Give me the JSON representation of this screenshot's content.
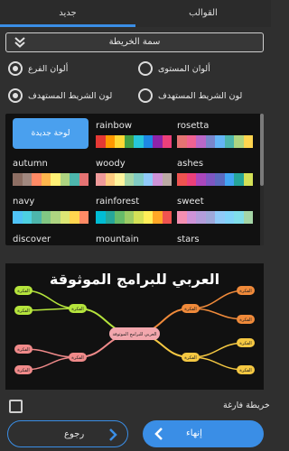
{
  "tabs": {
    "new": "جديد",
    "templates": "القوالب"
  },
  "theme_select": {
    "label": "سمة الخريطة"
  },
  "radios": {
    "level_colors": "ألوان المستوى",
    "branch_colors": "ألوان الفرع",
    "target_bar_colors_left": "لون الشريط المستهدف",
    "target_bar_colors_right": "لون الشريط المستهدف"
  },
  "new_board": "لوحة جديدة",
  "themes": [
    {
      "name": "rainbow",
      "colors": [
        "#e53935",
        "#ff9800",
        "#fdd835",
        "#43a047",
        "#26c6da",
        "#1e88e5",
        "#8e24aa",
        "#ec407a"
      ]
    },
    {
      "name": "rosetta",
      "colors": [
        "#e57373",
        "#f06292",
        "#ba68c8",
        "#7986cb",
        "#64b5f6",
        "#4db6ac",
        "#aed581",
        "#ffd54f"
      ]
    },
    {
      "name": "autumn",
      "colors": [
        "#8d6e63",
        "#a1887f",
        "#ff8a65",
        "#ffb74d",
        "#fff176",
        "#aed581",
        "#4db6ac",
        "#e57373"
      ]
    },
    {
      "name": "woody",
      "colors": [
        "#ef9a9a",
        "#ffcc80",
        "#fff59d",
        "#a5d6a7",
        "#80cbc4",
        "#90caf9",
        "#ce93d8",
        "#bcaaa4"
      ]
    },
    {
      "name": "ashes",
      "colors": [
        "#ef5350",
        "#ec407a",
        "#ab47bc",
        "#7e57c2",
        "#5c6bc0",
        "#42a5f5",
        "#26a69a",
        "#d4e157"
      ]
    },
    {
      "name": "navy",
      "colors": [
        "#4fc3f7",
        "#4dd0e1",
        "#4db6ac",
        "#81c784",
        "#aed581",
        "#dce775",
        "#ffd54f",
        "#ff8a65"
      ]
    },
    {
      "name": "rainforest",
      "colors": [
        "#00bcd4",
        "#26a69a",
        "#66bb6a",
        "#9ccc65",
        "#d4e157",
        "#ffee58",
        "#ffa726",
        "#ef5350"
      ]
    },
    {
      "name": "sweet",
      "colors": [
        "#f48fb1",
        "#ce93d8",
        "#b39ddb",
        "#9fa8da",
        "#90caf9",
        "#81d4fa",
        "#80deea",
        "#a5d6a7"
      ]
    },
    {
      "name": "discover",
      "colors": [
        "#00bcd4",
        "#ff5722",
        "#ffeb3b",
        "#4caf50",
        "#2196f3",
        "#9c27b0",
        "#e91e63",
        "#009688"
      ]
    },
    {
      "name": "mountain",
      "colors": [
        "#3f51b5",
        "#2196f3",
        "#03a9f4",
        "#00bcd4",
        "#009688",
        "#4caf50",
        "#8bc34a",
        "#cddc39"
      ]
    },
    {
      "name": "stars",
      "colors": [
        "#7c4dff",
        "#536dfe",
        "#448aff",
        "#40c4ff",
        "#18ffff",
        "#64ffda",
        "#69f0ae",
        "#b2ff59"
      ]
    }
  ],
  "preview": {
    "title": "العربي للبرامج الموثوقة",
    "center": "العربي للبرامج الموثوقة",
    "node_label": "الفكرة"
  },
  "blank_map": "خريطة فارغة",
  "buttons": {
    "back": "رجوع",
    "done": "إنهاء"
  },
  "colors": {
    "accent": "#3a8ee6",
    "branch_green": "#b5e43c",
    "branch_orange": "#f08a3a",
    "branch_yellow": "#f5c842",
    "branch_red": "#f08a8a",
    "center": "#f2a7ad"
  }
}
